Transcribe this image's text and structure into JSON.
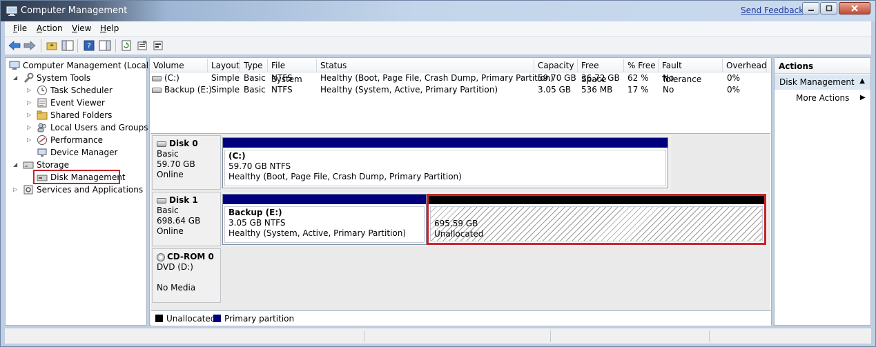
{
  "window": {
    "title": "Computer Management",
    "send_feedback": "Send Feedback"
  },
  "menu": [
    "File",
    "Action",
    "View",
    "Help"
  ],
  "tree": {
    "root": "Computer Management (Local)",
    "system_tools": "System Tools",
    "task_scheduler": "Task Scheduler",
    "event_viewer": "Event Viewer",
    "shared_folders": "Shared Folders",
    "local_users": "Local Users and Groups",
    "performance": "Performance",
    "device_manager": "Device Manager",
    "storage": "Storage",
    "disk_management": "Disk Management",
    "services": "Services and Applications"
  },
  "volume_list": {
    "columns": [
      "Volume",
      "Layout",
      "Type",
      "File System",
      "Status",
      "Capacity",
      "Free Space",
      "% Free",
      "Fault Tolerance",
      "Overhead"
    ],
    "rows": [
      [
        "(C:)",
        "Simple",
        "Basic",
        "NTFS",
        "Healthy (Boot, Page File, Crash Dump, Primary Partition)",
        "59.70 GB",
        "36.72 GB",
        "62 %",
        "No",
        "0%"
      ],
      [
        "Backup (E:)",
        "Simple",
        "Basic",
        "NTFS",
        "Healthy (System, Active, Primary Partition)",
        "3.05 GB",
        "536 MB",
        "17 %",
        "No",
        "0%"
      ]
    ]
  },
  "disks": {
    "disk0": {
      "name": "Disk 0",
      "type": "Basic",
      "size": "59.70 GB",
      "state": "Online",
      "partition": {
        "label": "(C:)",
        "size_fs": "59.70 GB NTFS",
        "status": "Healthy (Boot, Page File, Crash Dump, Primary Partition)"
      }
    },
    "disk1": {
      "name": "Disk 1",
      "type": "Basic",
      "size": "698.64 GB",
      "state": "Online",
      "partition": {
        "label": "Backup  (E:)",
        "size_fs": "3.05 GB NTFS",
        "status": "Healthy (System, Active, Primary Partition)"
      },
      "unallocated": {
        "size": "695.59 GB",
        "label": "Unallocated"
      }
    },
    "cdrom0": {
      "name": "CD-ROM 0",
      "type": "DVD (D:)",
      "media": "No Media"
    }
  },
  "legend": {
    "unallocated": "Unallocated",
    "primary": "Primary partition"
  },
  "actions": {
    "title": "Actions",
    "section": "Disk Management",
    "more": "More Actions"
  },
  "colors": {
    "primary_partition": "#00007f",
    "unallocated": "#000000",
    "highlight": "#c8232c"
  }
}
